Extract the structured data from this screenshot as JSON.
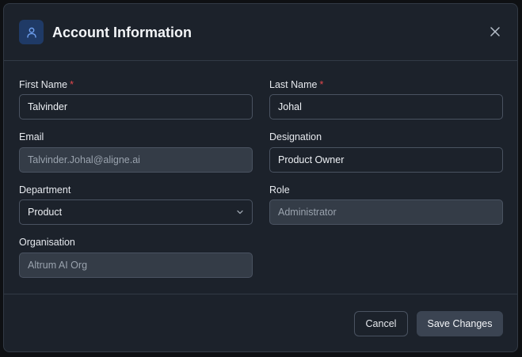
{
  "dialog": {
    "title": "Account Information",
    "close_icon": "close-icon",
    "header_icon": "user-icon"
  },
  "form": {
    "first_name": {
      "label": "First Name",
      "required": "*",
      "value": "Talvinder"
    },
    "last_name": {
      "label": "Last Name",
      "required": "*",
      "value": "Johal"
    },
    "email": {
      "label": "Email",
      "value": "Talvinder.Johal@aligne.ai",
      "disabled": true
    },
    "designation": {
      "label": "Designation",
      "value": "Product Owner"
    },
    "department": {
      "label": "Department",
      "value": "Product"
    },
    "role": {
      "label": "Role",
      "value": "Administrator",
      "disabled": true
    },
    "organisation": {
      "label": "Organisation",
      "value": "Altrum AI Org",
      "disabled": true
    }
  },
  "footer": {
    "cancel_label": "Cancel",
    "save_label": "Save Changes"
  },
  "colors": {
    "background": "#1c222b",
    "accent": "#1f3a66",
    "required": "#e5484d",
    "save_button": "#3b4452"
  }
}
